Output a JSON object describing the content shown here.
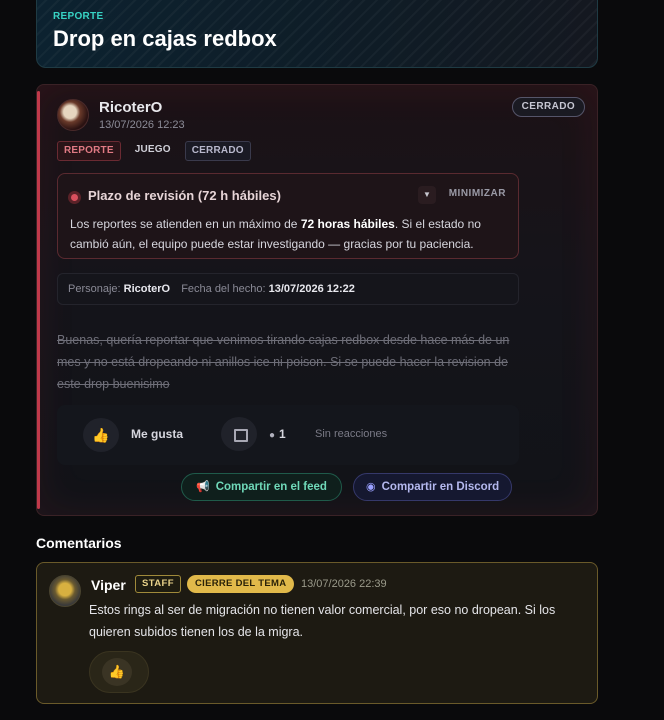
{
  "header": {
    "kicker": "REPORTE",
    "title": "Drop en cajas redbox"
  },
  "post": {
    "author": "RicoterO",
    "timestamp": "13/07/2026 12:23",
    "status": "CERRADO",
    "tags": [
      "REPORTE",
      "JUEGO",
      "CERRADO"
    ],
    "notice": {
      "title": "Plazo de revisión (72 h hábiles)",
      "minimize_label": "MINIMIZAR",
      "text_before": "Los reportes se atienden en un máximo de ",
      "text_bold": "72 horas hábiles",
      "text_after": ". Si el estado no cambió aún, el equipo puede estar investigando — gracias por tu paciencia."
    },
    "meta": {
      "character_label": "Personaje:",
      "character_value": "RicoterO",
      "date_label": "Fecha del hecho:",
      "date_value": "13/07/2026 12:22"
    },
    "body": "Buenas, quería reportar que venimos tirando cajas redbox desde hace más de un mes y no está dropeando ni anillos ice ni poison. Si se puede hacer la revision de este drop buenisimo",
    "reactions": {
      "like_label": "Me gusta",
      "comment_count": "1",
      "reactions_text": "Sin reacciones"
    },
    "share": {
      "feed_label": "Compartir en el feed",
      "discord_label": "Compartir en Discord"
    }
  },
  "comments": {
    "heading": "Comentarios",
    "items": [
      {
        "author": "Viper",
        "badge": "STAFF",
        "role": "CIERRE DEL TEMA",
        "timestamp": "13/07/2026 22:39",
        "text": "Estos rings al ser de migración no tienen valor comercial, por eso no dropean. Si los quieren subidos tienen los de la migra."
      }
    ]
  },
  "colors": {
    "accent_red": "#c0394a",
    "teal": "#37d3c4",
    "gold": "#e1b94a"
  }
}
